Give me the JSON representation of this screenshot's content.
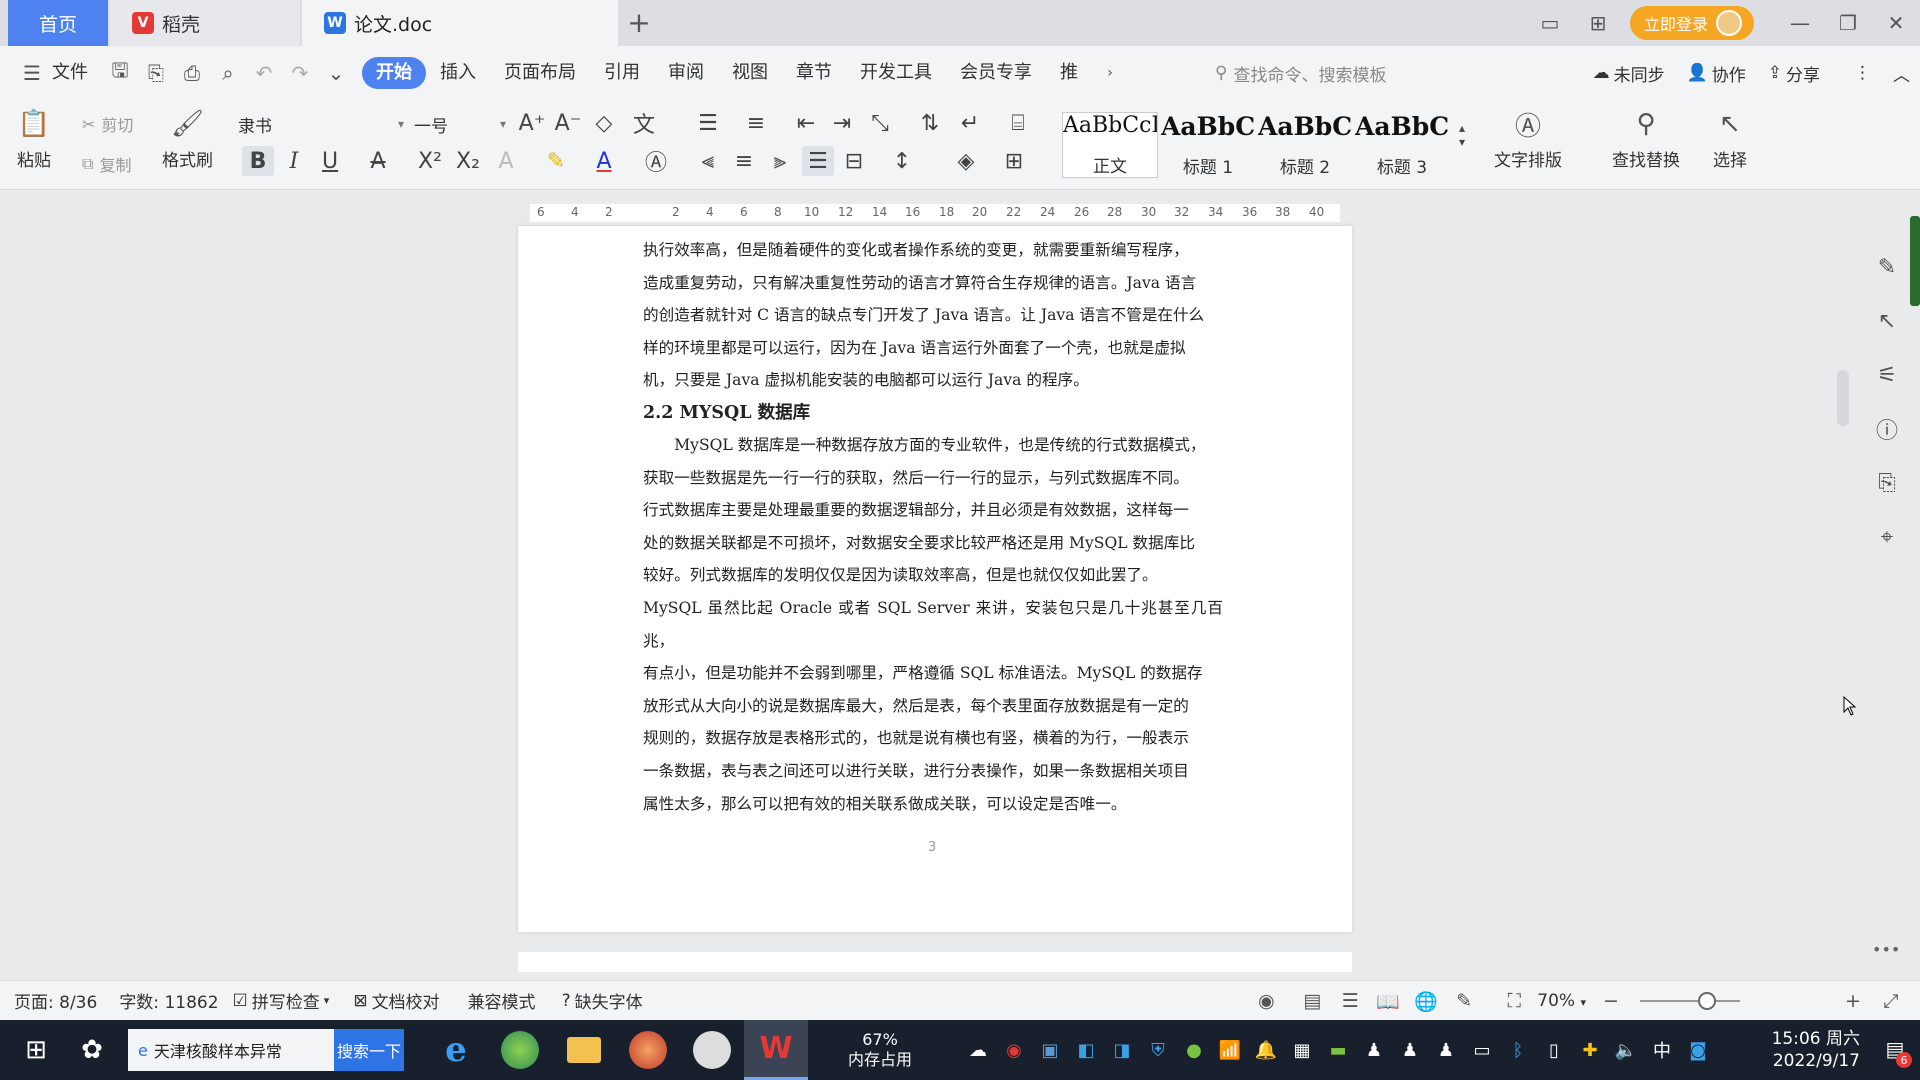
{
  "tabs": {
    "home": "首页",
    "daoke": "稻壳",
    "doc": "论文.doc"
  },
  "titlebar": {
    "login_label": "立即登录"
  },
  "menu": {
    "file": "文件",
    "items": [
      "开始",
      "插入",
      "页面布局",
      "引用",
      "审阅",
      "视图",
      "章节",
      "开发工具",
      "会员专享",
      "推"
    ],
    "search_placeholder": "查找命令、搜索模板",
    "sync": "未同步",
    "collab": "协作",
    "share": "分享"
  },
  "ribbon": {
    "paste": "粘贴",
    "cut": "剪切",
    "copy": "复制",
    "format_painter": "格式刷",
    "font_name": "隶书",
    "font_size": "一号",
    "styles": [
      {
        "sample": "AaBbCcI",
        "name": "正文"
      },
      {
        "sample": "AaBbC",
        "name": "标题 1"
      },
      {
        "sample": "AaBbC",
        "name": "标题 2"
      },
      {
        "sample": "AaBbC",
        "name": "标题 3"
      }
    ],
    "text_layout": "文字排版",
    "find_replace": "查找替换",
    "select": "选择"
  },
  "ruler": {
    "labels": [
      "6",
      "4",
      "2",
      "2",
      "4",
      "6",
      "8",
      "10",
      "12",
      "14",
      "16",
      "18",
      "20",
      "22",
      "24",
      "26",
      "28",
      "30",
      "32",
      "34",
      "36",
      "38",
      "40"
    ]
  },
  "document": {
    "paragraph1_lines": [
      "执行效率高，但是随着硬件的变化或者操作系统的变更，就需要重新编写程序，",
      "造成重复劳动，只有解决重复性劳动的语言才算符合生存规律的语言。Java 语言",
      "的创造者就针对 C 语言的缺点专门开发了 Java 语言。让 Java 语言不管是在什么",
      "样的环境里都是可以运行，因为在 Java 语言运行外面套了一个壳，也就是虚拟",
      "机，只要是 Java 虚拟机能安装的电脑都可以运行 Java 的程序。"
    ],
    "heading": "2.2 MYSQL 数据库",
    "paragraph2_lines": [
      "MySQL 数据库是一种数据存放方面的专业软件，也是传统的行式数据模式，",
      "获取一些数据是先一行一行的获取，然后一行一行的显示，与列式数据库不同。",
      "行式数据库主要是处理最重要的数据逻辑部分，并且必须是有效数据，这样每一",
      "处的数据关联都是不可损坏，对数据安全要求比较严格还是用 MySQL 数据库比",
      "较好。列式数据库的发明仅仅是因为读取效率高，但是也就仅仅如此罢了。",
      "MySQL 虽然比起 Oracle 或者 SQL Server 来讲，安装包只是几十兆甚至几百兆，",
      "有点小，但是功能并不会弱到哪里，严格遵循 SQL 标准语法。MySQL 的数据存",
      "放形式从大向小的说是数据库最大，然后是表，每个表里面存放数据是有一定的",
      "规则的，数据存放是表格形式的，也就是说有横也有竖，横着的为行，一般表示",
      "一条数据，表与表之间还可以进行关联，进行分表操作，如果一条数据相关项目",
      "属性太多，那么可以把有效的相关联系做成关联，可以设定是否唯一。"
    ],
    "page_number": "3"
  },
  "statusbar": {
    "page": "页面: 8/36",
    "words": "字数: 11862",
    "spell": "拼写检查",
    "proofread": "文档校对",
    "compat": "兼容模式",
    "missing_font": "缺失字体",
    "zoom": "70%"
  },
  "taskbar": {
    "search_text": "天津核酸样本异常",
    "search_button": "搜索一下",
    "memory_percent": "67%",
    "memory_label": "内存占用",
    "ime": "中",
    "time": "15:06 周六",
    "date": "2022/9/17",
    "notif_count": "6"
  },
  "colors": {
    "accent": "#4d82f0",
    "login": "#f5a623",
    "taskbar": "#17202c"
  }
}
